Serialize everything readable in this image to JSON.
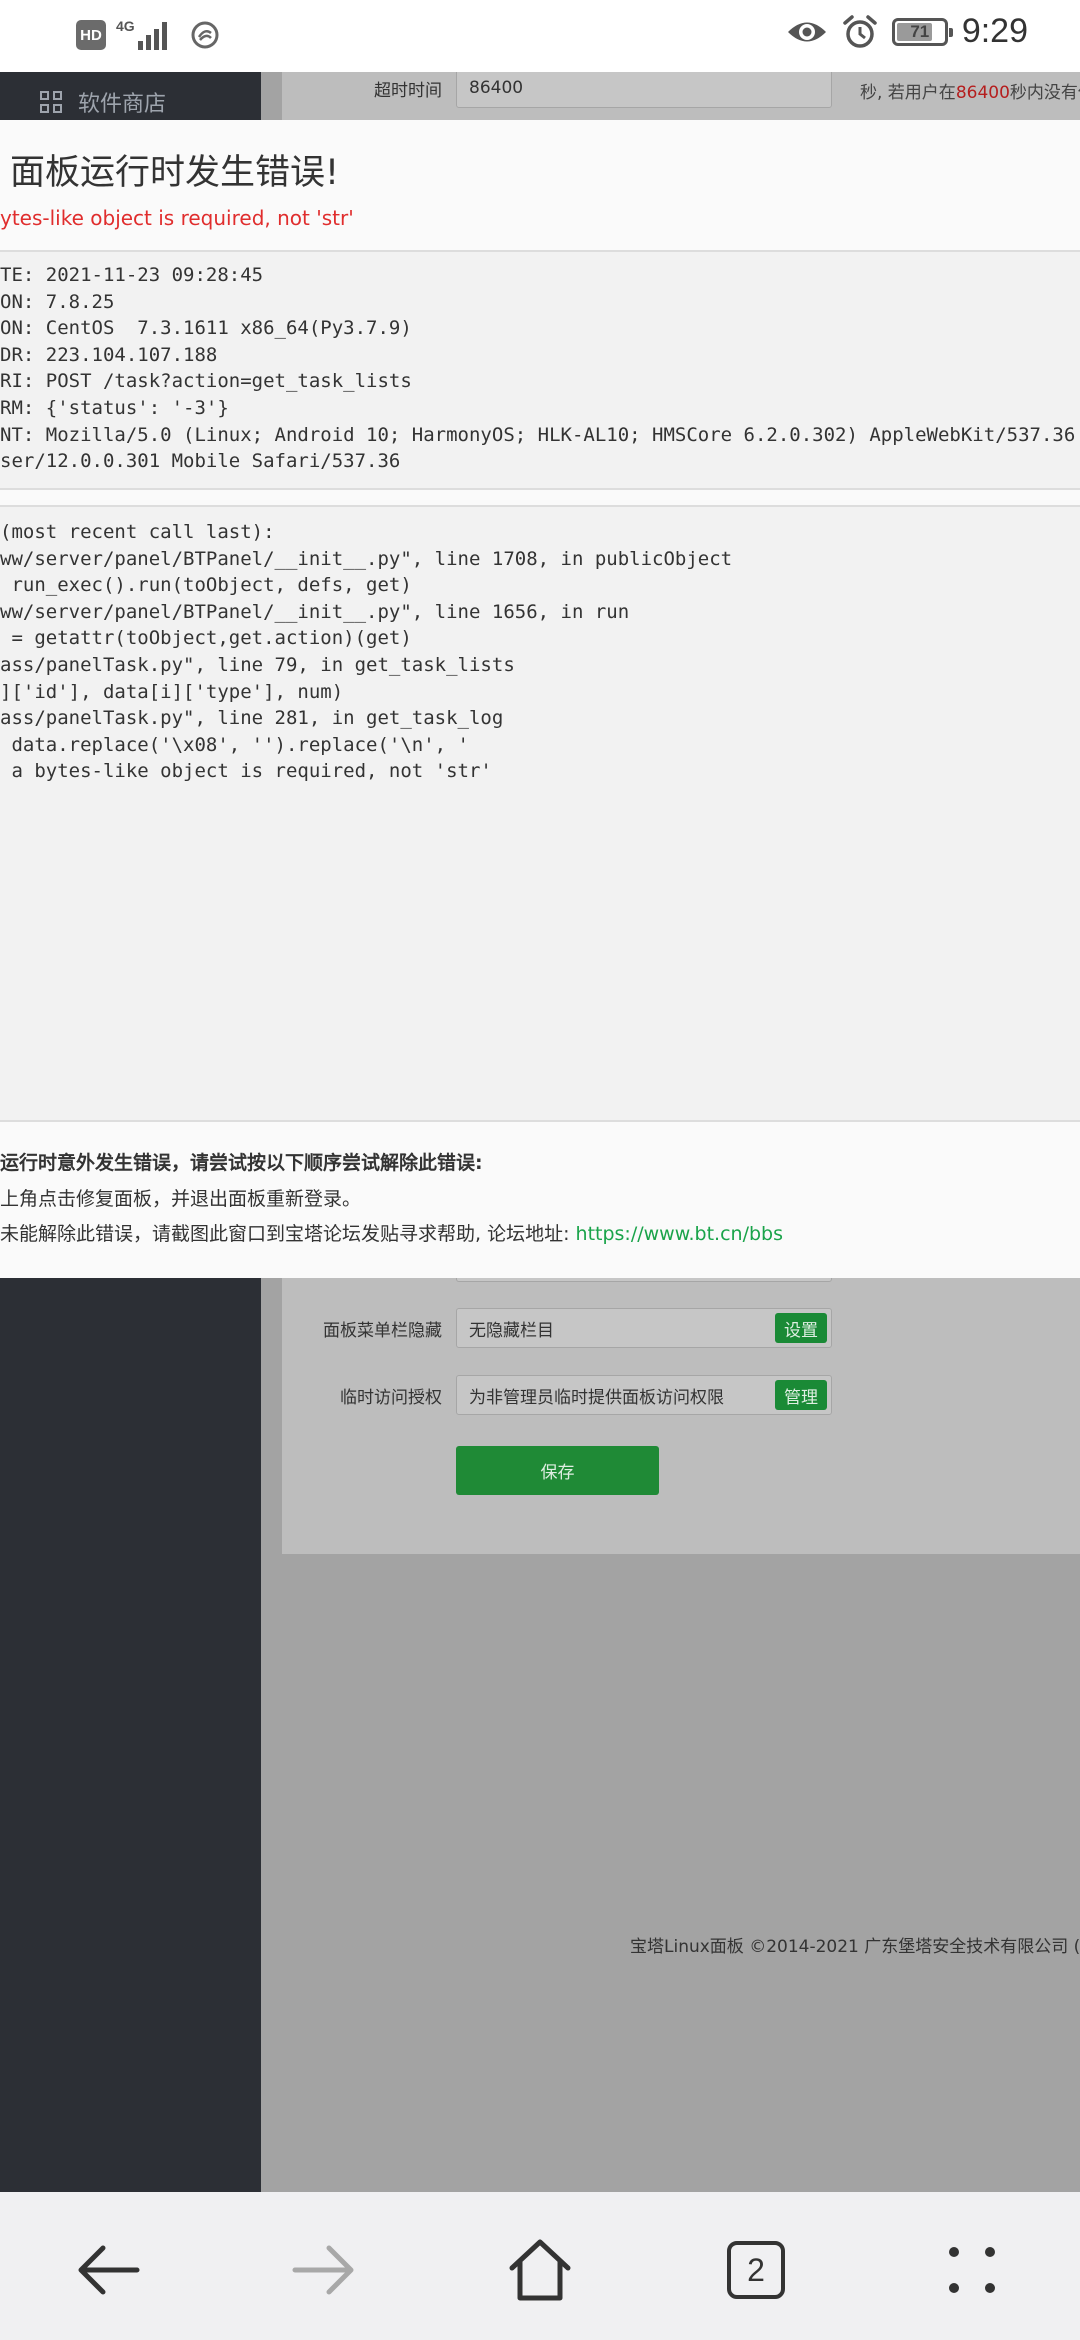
{
  "status_bar": {
    "hd_label": "HD",
    "network_label": "4G",
    "battery_level": "71",
    "time": "9:29",
    "icons": [
      "hd-icon",
      "signal-icon",
      "app-notification-icon",
      "eye-icon",
      "alarm-icon",
      "battery-icon"
    ]
  },
  "sidebar": {
    "items": [
      {
        "label": "软件商店",
        "icon": "grid-icon"
      }
    ]
  },
  "settings": {
    "timeout_label": "超时时间",
    "timeout_value": "86400",
    "timeout_hint_pre": "秒, 若用户在",
    "timeout_hint_value": "86400",
    "timeout_hint_post": "秒内没有任",
    "menu_hide_label": "面板菜单栏隐藏",
    "menu_hide_value": "无隐藏栏目",
    "menu_hide_button": "设置",
    "temp_access_label": "临时访问授权",
    "temp_access_value": "为非管理员临时提供面板访问权限",
    "temp_access_button": "管理",
    "save_button": "保存"
  },
  "footer": {
    "copyright": "宝塔Linux面板 ©2014-2021 广东堡塔安全技术有限公司 (b"
  },
  "error_dialog": {
    "title": "面板运行时发生错误!",
    "subtitle": "ytes-like object is required, not 'str'",
    "info_lines": [
      "TE: 2021-11-23 09:28:45",
      "ON: 7.8.25",
      "ON: CentOS  7.3.1611 x86_64(Py3.7.9)",
      "DR: 223.104.107.188",
      "RI: POST /task?action=get_task_lists",
      "RM: {'status': '-3'}",
      "NT: Mozilla/5.0 (Linux; Android 10; HarmonyOS; HLK-AL10; HMSCore 6.2.0.302) AppleWebKit/537.36 (",
      "ser/12.0.0.301 Mobile Safari/537.36"
    ],
    "trace_lines": [
      "(most recent call last):",
      "ww/server/panel/BTPanel/__init__.py\", line 1708, in publicObject",
      " run_exec().run(toObject, defs, get)",
      "ww/server/panel/BTPanel/__init__.py\", line 1656, in run",
      " = getattr(toObject,get.action)(get)",
      "ass/panelTask.py\", line 79, in get_task_lists",
      "]['id'], data[i]['type'], num)",
      "ass/panelTask.py\", line 281, in get_task_log",
      " data.replace('\\x08', '').replace('\\n', '",
      "",
      " a bytes-like object is required, not 'str'"
    ],
    "help_title": "运行时意外发生错误，请尝试按以下顺序尝试解除此错误:",
    "help_step1": "上角点击修复面板，并退出面板重新登录。",
    "help_step2": "未能解除此错误，请截图此窗口到宝塔论坛发贴寻求帮助, 论坛地址: ",
    "forum_url": "https://www.bt.cn/bbs"
  },
  "nav_bar": {
    "tab_count": "2",
    "icons": [
      "back-arrow-icon",
      "forward-arrow-icon",
      "home-icon",
      "tabs-icon",
      "more-icon"
    ]
  }
}
